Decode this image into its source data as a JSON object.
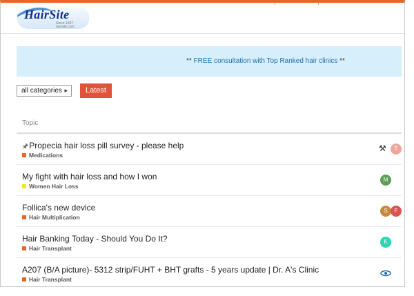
{
  "logo": {
    "title": "HairSite",
    "tagline": "Since 1997",
    "domain": "hairsite.com"
  },
  "banner": {
    "prefix": "** ",
    "link_text": "FREE consultation with Top Ranked hair clinics",
    "suffix": " **"
  },
  "filters": {
    "category_label": "all categories",
    "latest_label": "Latest"
  },
  "list_header": "Topic",
  "topics": [
    {
      "pinned": true,
      "title": "Propecia hair loss pill survey - please help",
      "category": "Medications",
      "category_color": "#e8662a",
      "avatars": [
        {
          "kind": "cutlery-icon"
        },
        {
          "letter": "T",
          "color": "#f0a79b"
        }
      ]
    },
    {
      "pinned": false,
      "title": "My fight with hair loss and how I won",
      "category": "Women Hair Loss",
      "category_color": "#f2e52b",
      "avatars": [
        {
          "letter": "M",
          "color": "#5a9e5a"
        }
      ]
    },
    {
      "pinned": false,
      "title": "Follica's new device",
      "category": "Hair Multiplication",
      "category_color": "#e8662a",
      "avatars": [
        {
          "letter": "S",
          "color": "#c58a3e"
        },
        {
          "letter": "F",
          "color": "#d9534f"
        }
      ]
    },
    {
      "pinned": false,
      "title": "Hair Banking Today - Should You Do It?",
      "category": "Hair Transplant",
      "category_color": "#e8662a",
      "avatars": [
        {
          "letter": "K",
          "color": "#2dd4b4"
        }
      ]
    },
    {
      "pinned": false,
      "title": "A207 (B/A picture)- 5312 strip/FUHT + BHT grafts - 5 years update | Dr. A's Clinic",
      "category": "Hair Transplant",
      "category_color": "#e8662a",
      "avatars": [
        {
          "kind": "eye-icon"
        }
      ]
    }
  ]
}
